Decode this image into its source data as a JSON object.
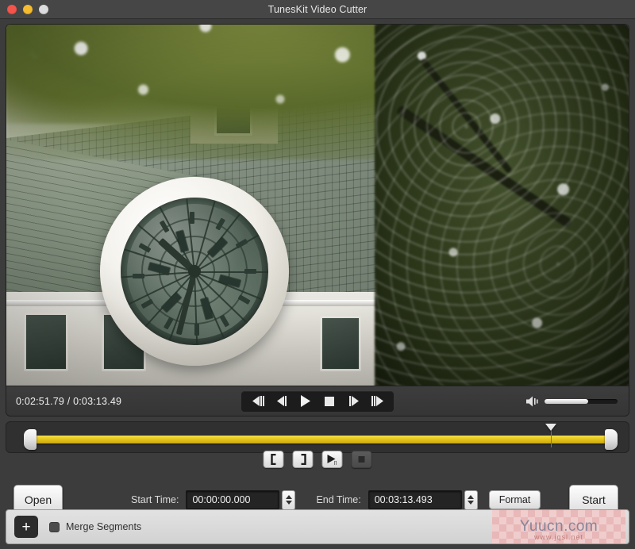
{
  "window": {
    "title": "TunesKit Video Cutter",
    "traffic_lights": [
      {
        "name": "close",
        "color": "#f5544c"
      },
      {
        "name": "minimize",
        "color": "#f6bc2f"
      },
      {
        "name": "maximize",
        "color": "#dcdcdc"
      }
    ]
  },
  "player": {
    "time_readout": "0:02:51.79 / 0:03:13.49",
    "current_time": "0:02:51.79",
    "total_time": "0:03:13.49",
    "transport": [
      {
        "name": "step-back-fast-button",
        "icon": "step-back-fast-icon"
      },
      {
        "name": "step-back-button",
        "icon": "step-back-icon"
      },
      {
        "name": "play-button",
        "icon": "play-icon"
      },
      {
        "name": "stop-button",
        "icon": "stop-icon"
      },
      {
        "name": "step-forward-button",
        "icon": "step-forward-icon"
      },
      {
        "name": "step-forward-fast-button",
        "icon": "step-forward-fast-icon"
      }
    ],
    "volume": {
      "icon": "volume-icon",
      "level_percent": 60
    }
  },
  "timeline": {
    "start_handle_percent": 0,
    "end_handle_percent": 100,
    "playhead_percent": 88,
    "track_color": "#e7c61d",
    "playhead_color": "#d94d2a"
  },
  "clip_tools": [
    {
      "name": "set-start-button",
      "icon": "bracket-left-icon",
      "label": "[",
      "enabled": true
    },
    {
      "name": "set-end-button",
      "icon": "bracket-right-icon",
      "label": "]",
      "enabled": true
    },
    {
      "name": "preview-segment-button",
      "icon": "play-segment-icon",
      "enabled": true
    },
    {
      "name": "stop-preview-button",
      "icon": "stop-square-icon",
      "enabled": false
    }
  ],
  "settings": {
    "open_label": "Open",
    "start_time_label": "Start Time:",
    "start_time_value": "00:00:00.000",
    "end_time_label": "End Time:",
    "end_time_value": "00:03:13.493",
    "format_label": "Format",
    "start_label": "Start"
  },
  "bottom": {
    "add_label": "+",
    "merge_label": "Merge Segments",
    "merge_checked": false,
    "watermark_text": "Yuucn.com",
    "watermark_sub": "www.jqsl.net"
  }
}
